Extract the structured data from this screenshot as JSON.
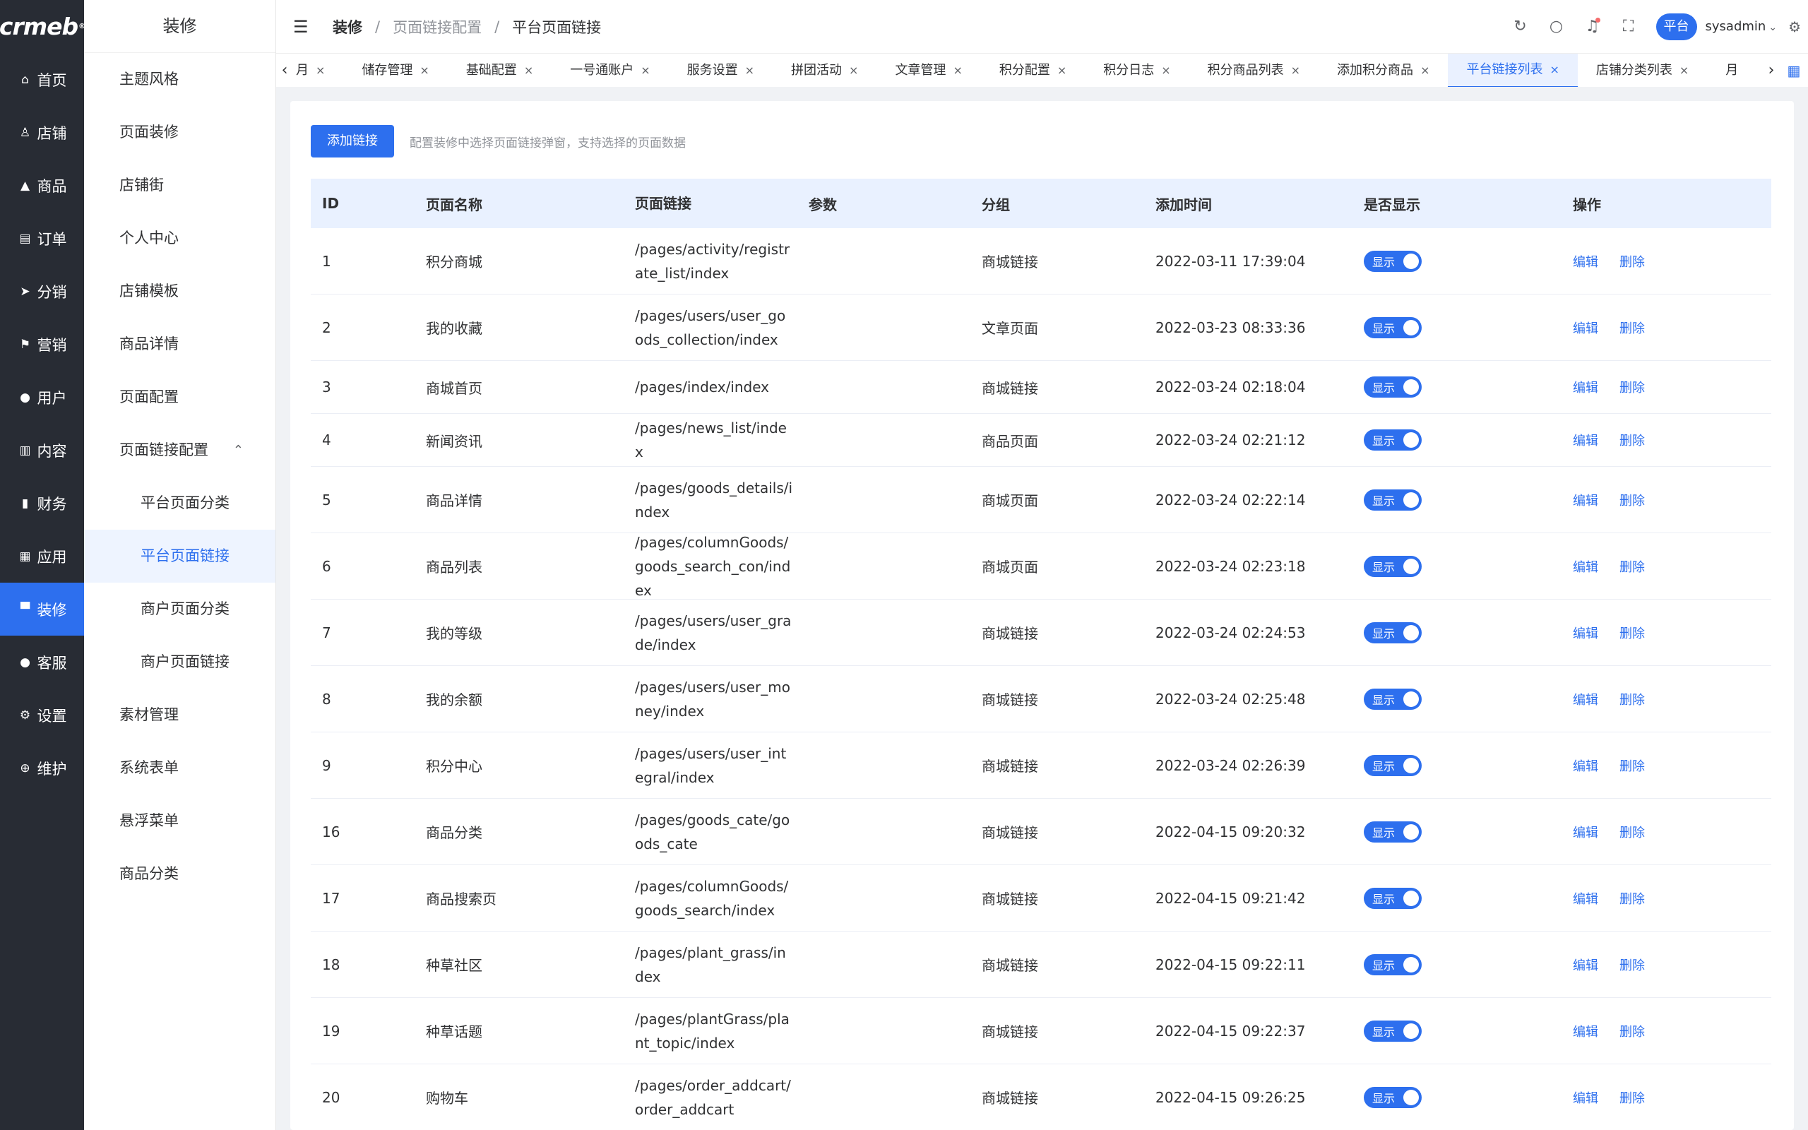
{
  "logo": "crmeb",
  "nav": [
    {
      "label": "首页",
      "icon": "home-icon",
      "glyph": "⌂"
    },
    {
      "label": "店铺",
      "icon": "store-user-icon",
      "glyph": "♙"
    },
    {
      "label": "商品",
      "icon": "bag-icon",
      "glyph": "▲"
    },
    {
      "label": "订单",
      "icon": "clipboard-icon",
      "glyph": "▤"
    },
    {
      "label": "分销",
      "icon": "send-icon",
      "glyph": "➤"
    },
    {
      "label": "营销",
      "icon": "flag-icon",
      "glyph": "⚑"
    },
    {
      "label": "用户",
      "icon": "user-icon",
      "glyph": "●"
    },
    {
      "label": "内容",
      "icon": "book-icon",
      "glyph": "▥"
    },
    {
      "label": "财务",
      "icon": "bar-chart-icon",
      "glyph": "▮"
    },
    {
      "label": "应用",
      "icon": "grid-icon",
      "glyph": "▦"
    },
    {
      "label": "装修",
      "icon": "paint-roller-icon",
      "glyph": "▀"
    },
    {
      "label": "客服",
      "icon": "support-icon",
      "glyph": "●"
    },
    {
      "label": "设置",
      "icon": "gear-icon",
      "glyph": "⚙"
    },
    {
      "label": "维护",
      "icon": "wrench-icon",
      "glyph": "⊕"
    }
  ],
  "submenu": {
    "title": "装修",
    "items": [
      {
        "label": "主题风格"
      },
      {
        "label": "页面装修"
      },
      {
        "label": "店铺街"
      },
      {
        "label": "个人中心"
      },
      {
        "label": "店铺模板"
      },
      {
        "label": "商品详情"
      },
      {
        "label": "页面配置"
      },
      {
        "label": "页面链接配置"
      },
      {
        "label": "平台页面分类"
      },
      {
        "label": "平台页面链接"
      },
      {
        "label": "商户页面分类"
      },
      {
        "label": "商户页面链接"
      },
      {
        "label": "素材管理"
      },
      {
        "label": "系统表单"
      },
      {
        "label": "悬浮菜单"
      },
      {
        "label": "商品分类"
      }
    ]
  },
  "breadcrumb": {
    "c0": "装修",
    "c1": "页面链接配置",
    "c2": "平台页面链接"
  },
  "header": {
    "badge": "平台",
    "user": "sysadmin"
  },
  "tabs": [
    {
      "label": "月"
    },
    {
      "label": "储存管理"
    },
    {
      "label": "基础配置"
    },
    {
      "label": "一号通账户"
    },
    {
      "label": "服务设置"
    },
    {
      "label": "拼团活动"
    },
    {
      "label": "文章管理"
    },
    {
      "label": "积分配置"
    },
    {
      "label": "积分日志"
    },
    {
      "label": "积分商品列表"
    },
    {
      "label": "添加积分商品"
    },
    {
      "label": "平台链接列表"
    },
    {
      "label": "店铺分类列表"
    },
    {
      "label": "月"
    }
  ],
  "toolbar": {
    "add_label": "添加链接",
    "hint": "配置装修中选择页面链接弹窗，支持选择的页面数据"
  },
  "table": {
    "headers": {
      "id": "ID",
      "name": "页面名称",
      "link": "页面链接",
      "param": "参数",
      "group": "分组",
      "time": "添加时间",
      "show": "是否显示",
      "op": "操作"
    },
    "switch_label": "显示",
    "edit_label": "编辑",
    "delete_label": "删除",
    "rows": [
      {
        "id": "1",
        "name": "积分商城",
        "link": "/pages/activity/registrate_list/index",
        "param": "",
        "group": "商城链接",
        "time": "2022-03-11 17:39:04"
      },
      {
        "id": "2",
        "name": "我的收藏",
        "link": "/pages/users/user_goods_collection/index",
        "param": "",
        "group": "文章页面",
        "time": "2022-03-23 08:33:36"
      },
      {
        "id": "3",
        "name": "商城首页",
        "link": "/pages/index/index",
        "param": "",
        "group": "商城链接",
        "time": "2022-03-24 02:18:04"
      },
      {
        "id": "4",
        "name": "新闻资讯",
        "link": "/pages/news_list/index",
        "param": "",
        "group": "商品页面",
        "time": "2022-03-24 02:21:12"
      },
      {
        "id": "5",
        "name": "商品详情",
        "link": "/pages/goods_details/index",
        "param": "",
        "group": "商城页面",
        "time": "2022-03-24 02:22:14"
      },
      {
        "id": "6",
        "name": "商品列表",
        "link": "/pages/columnGoods/goods_search_con/index",
        "param": "",
        "group": "商城页面",
        "time": "2022-03-24 02:23:18"
      },
      {
        "id": "7",
        "name": "我的等级",
        "link": "/pages/users/user_grade/index",
        "param": "",
        "group": "商城链接",
        "time": "2022-03-24 02:24:53"
      },
      {
        "id": "8",
        "name": "我的余额",
        "link": "/pages/users/user_money/index",
        "param": "",
        "group": "商城链接",
        "time": "2022-03-24 02:25:48"
      },
      {
        "id": "9",
        "name": "积分中心",
        "link": "/pages/users/user_integral/index",
        "param": "",
        "group": "商城链接",
        "time": "2022-03-24 02:26:39"
      },
      {
        "id": "16",
        "name": "商品分类",
        "link": "/pages/goods_cate/goods_cate",
        "param": "",
        "group": "商城链接",
        "time": "2022-04-15 09:20:32"
      },
      {
        "id": "17",
        "name": "商品搜索页",
        "link": "/pages/columnGoods/goods_search/index",
        "param": "",
        "group": "商城链接",
        "time": "2022-04-15 09:21:42"
      },
      {
        "id": "18",
        "name": "种草社区",
        "link": "/pages/plant_grass/index",
        "param": "",
        "group": "商城链接",
        "time": "2022-04-15 09:22:11"
      },
      {
        "id": "19",
        "name": "种草话题",
        "link": "/pages/plantGrass/plant_topic/index",
        "param": "",
        "group": "商城链接",
        "time": "2022-04-15 09:22:37"
      },
      {
        "id": "20",
        "name": "购物车",
        "link": "/pages/order_addcart/order_addcart",
        "param": "",
        "group": "商城链接",
        "time": "2022-04-15 09:26:25"
      }
    ]
  }
}
